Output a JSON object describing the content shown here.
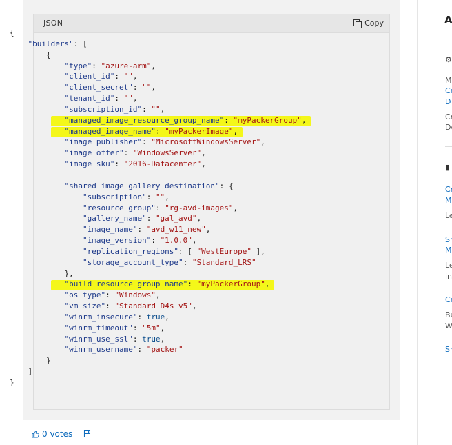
{
  "code_block": {
    "language": "JSON",
    "copy_label": "Copy",
    "lines": [
      "{",
      "    \"builders\": [",
      "        {",
      "            \"type\": \"azure-arm\",",
      "            \"client_id\": \"\",",
      "            \"client_secret\": \"\",",
      "            \"tenant_id\": \"\",",
      "            \"subscription_id\": \"\",",
      "            \"managed_image_resource_group_name\": \"myPackerGroup\",",
      "            \"managed_image_name\": \"myPackerImage\",",
      "            \"image_publisher\": \"MicrosoftWindowsServer\",",
      "            \"image_offer\": \"WindowsServer\",",
      "            \"image_sku\": \"2016-Datacenter\",",
      "",
      "            \"shared_image_gallery_destination\": {",
      "                \"subscription\": \"\",",
      "                \"resource_group\": \"rg-avd-images\",",
      "                \"gallery_name\": \"gal_avd\",",
      "                \"image_name\": \"avd_w11_new\",",
      "                \"image_version\": \"1.0.0\",",
      "                \"replication_regions\": [ \"WestEurope\" ],",
      "                \"storage_account_type\": \"Standard_LRS\"",
      "            },",
      "            \"build_resource_group_name\": \"myPackerGroup\",",
      "            \"os_type\": \"Windows\",",
      "            \"vm_size\": \"Standard_D4s_v5\",",
      "            \"winrm_insecure\": true,",
      "            \"winrm_timeout\": \"5m\",",
      "            \"winrm_use_ssl\": true,",
      "            \"winrm_username\": \"packer\"",
      "        }",
      "    ]",
      "}"
    ],
    "highlighted_lines": [
      8,
      9,
      23
    ],
    "highlight_color": "#f4f71a"
  },
  "footer": {
    "votes_label": "0 votes"
  },
  "sidebar": {
    "title": "A",
    "items": [
      "Mo",
      "Cr",
      "D",
      "Cr",
      "De",
      "Cr",
      "M",
      "Le",
      "Sh",
      "M",
      "Le",
      "in",
      "Cr",
      "Bu",
      "W",
      "Sh"
    ]
  },
  "colors": {
    "link": "#0f6cbd",
    "string": "#a31515",
    "key": "#1e3a8a"
  }
}
